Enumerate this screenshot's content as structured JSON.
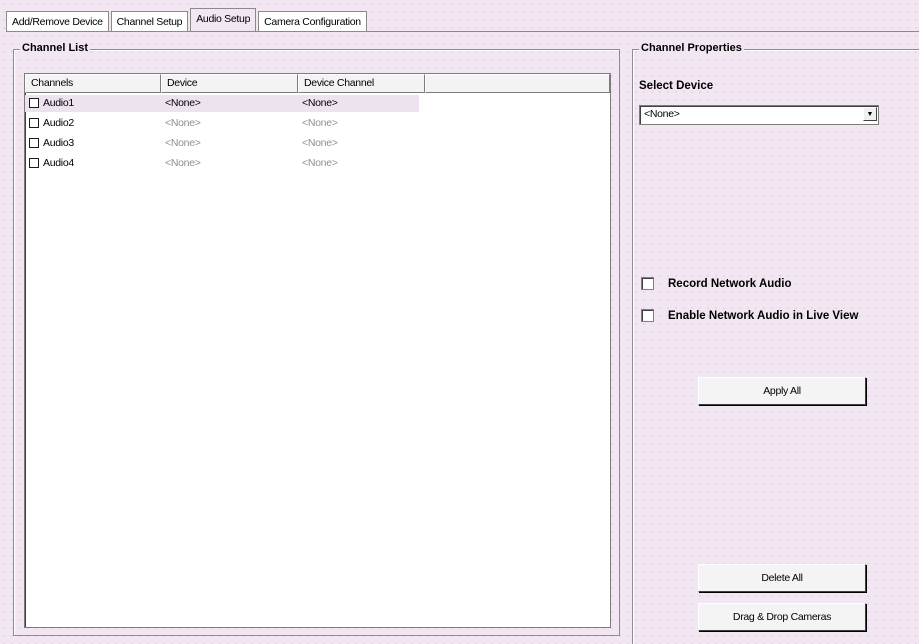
{
  "tabs": [
    {
      "label": "Add/Remove Device"
    },
    {
      "label": "Channel Setup"
    },
    {
      "label": "Audio Setup"
    },
    {
      "label": "Camera Configuration"
    }
  ],
  "channel_list": {
    "title": "Channel List",
    "columns": [
      "Channels",
      "Device",
      "Device Channel"
    ],
    "rows": [
      {
        "channel": "Audio1",
        "device": "<None>",
        "device_channel": "<None>",
        "selected": true
      },
      {
        "channel": "Audio2",
        "device": "<None>",
        "device_channel": "<None>",
        "selected": false
      },
      {
        "channel": "Audio3",
        "device": "<None>",
        "device_channel": "<None>",
        "selected": false
      },
      {
        "channel": "Audio4",
        "device": "<None>",
        "device_channel": "<None>",
        "selected": false
      }
    ]
  },
  "channel_properties": {
    "title": "Channel Properties",
    "select_device_label": "Select Device",
    "select_device_value": "<None>",
    "record_network_audio": "Record Network Audio",
    "enable_network_audio": "Enable Network Audio in Live View",
    "apply_all": "Apply All",
    "delete_all": "Delete All",
    "drag_drop": "Drag & Drop Cameras"
  }
}
